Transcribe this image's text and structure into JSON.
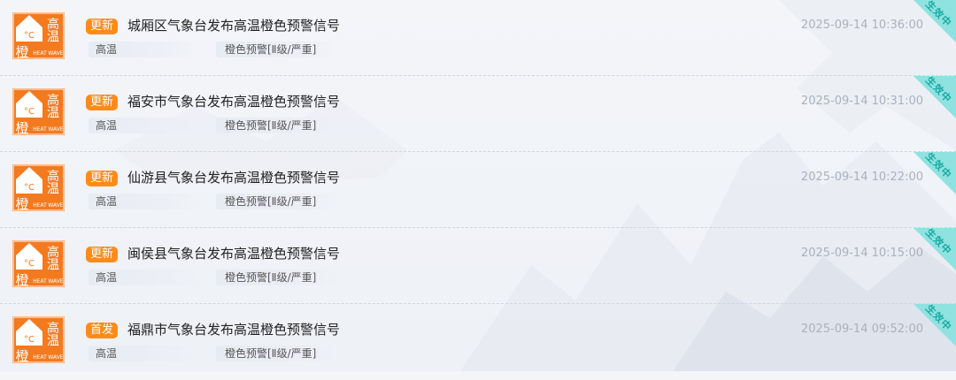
{
  "colors": {
    "badge_orange": "#fb8c1c",
    "icon_orange": "#f47a1f",
    "status_teal": "#8fe2e0",
    "time_gray": "#aab2bd"
  },
  "icon": {
    "name": "high-temperature-orange-warning-icon",
    "char_orange": "橙",
    "char_high": "高",
    "char_temp": "温",
    "unit": "°C",
    "en_heat": "HEAT",
    "en_wave": "WAVE"
  },
  "alerts": [
    {
      "badge": "更新",
      "title": "城厢区气象台发布高温橙色预警信号",
      "type": "高温",
      "level": "橙色预警[Ⅱ级/严重]",
      "time": "2025-09-14 10:36:00",
      "status": "生效中"
    },
    {
      "badge": "更新",
      "title": "福安市气象台发布高温橙色预警信号",
      "type": "高温",
      "level": "橙色预警[Ⅱ级/严重]",
      "time": "2025-09-14 10:31:00",
      "status": "生效中"
    },
    {
      "badge": "更新",
      "title": "仙游县气象台发布高温橙色预警信号",
      "type": "高温",
      "level": "橙色预警[Ⅱ级/严重]",
      "time": "2025-09-14 10:22:00",
      "status": "生效中"
    },
    {
      "badge": "更新",
      "title": "闽侯县气象台发布高温橙色预警信号",
      "type": "高温",
      "level": "橙色预警[Ⅱ级/严重]",
      "time": "2025-09-14 10:15:00",
      "status": "生效中"
    },
    {
      "badge": "首发",
      "title": "福鼎市气象台发布高温橙色预警信号",
      "type": "高温",
      "level": "橙色预警[Ⅱ级/严重]",
      "time": "2025-09-14 09:52:00",
      "status": "生效中"
    }
  ]
}
